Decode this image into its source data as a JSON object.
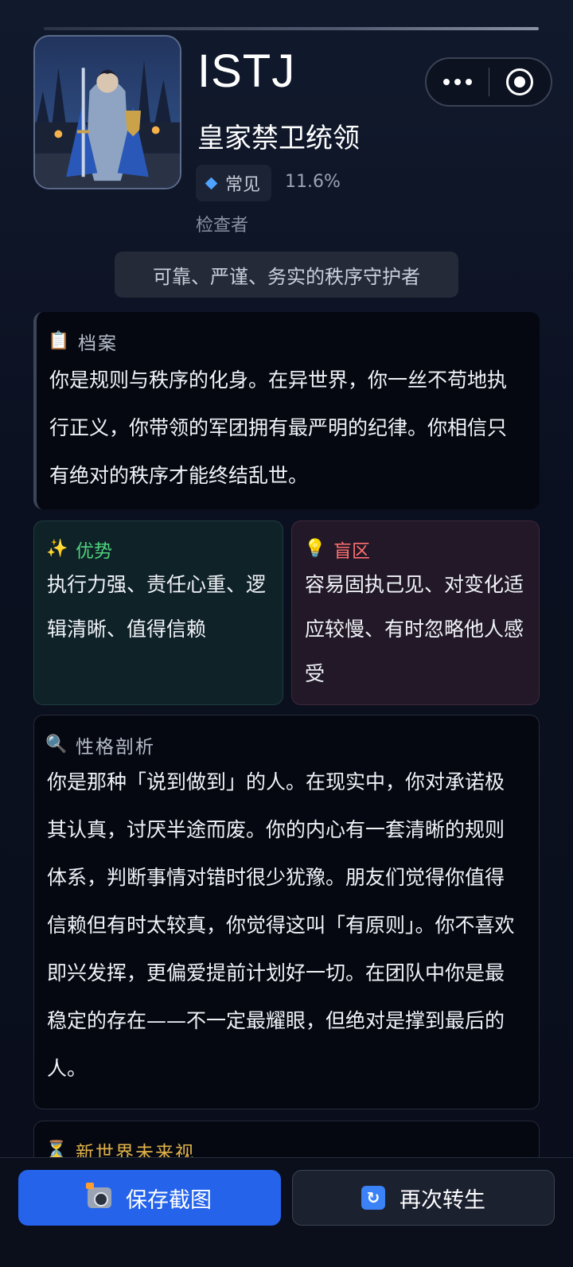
{
  "header": {
    "type_code": "ISTJ",
    "type_name": "皇家禁卫统领",
    "rarity_label": "常见",
    "rarity_pct": "11.6%",
    "alias": "检查者",
    "tagline": "可靠、严谨、务实的秩序守护者"
  },
  "profile": {
    "icon": "clipboard-icon",
    "title": "档案",
    "body": "你是规则与秩序的化身。在异世界，你一丝不苟地执行正义，你带领的军团拥有最严明的纪律。你相信只有绝对的秩序才能终结乱世。"
  },
  "strengths": {
    "icon": "sparkles-icon",
    "title": "优势",
    "body": "执行力强、责任心重、逻辑清晰、值得信赖"
  },
  "blindspots": {
    "icon": "lightbulb-icon",
    "title": "盲区",
    "body": "容易固执己见、对变化适应较慢、有时忽略他人感受"
  },
  "analysis": {
    "icon": "magnifier-icon",
    "title": "性格剖析",
    "body": "你是那种「说到做到」的人。在现实中，你对承诺极其认真，讨厌半途而废。你的内心有一套清晰的规则体系，判断事情对错时很少犹豫。朋友们觉得你值得信赖但有时太较真，你觉得这叫「有原则」。你不喜欢即兴发挥，更偏爱提前计划好一切。在团队中你是最稳定的存在——不一定最耀眼，但绝对是撑到最后的人。"
  },
  "future": {
    "icon": "hourglass-icon",
    "title": "新世界未来视"
  },
  "actions": {
    "save_label": "保存截图",
    "reborn_label": "再次转生"
  },
  "colors": {
    "accent": "#2563eb",
    "strength": "#4fd17c",
    "blindspot": "#ff6f6f",
    "future": "#e0b24a"
  }
}
